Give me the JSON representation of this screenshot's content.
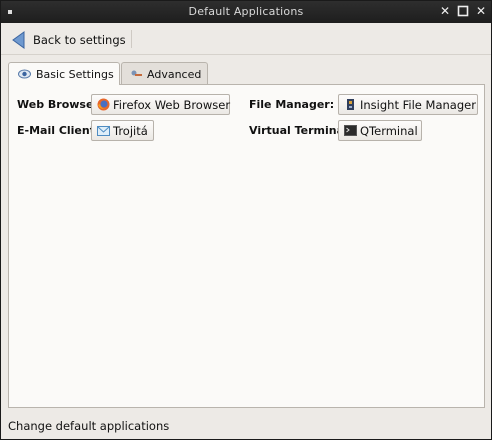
{
  "window": {
    "title": "Default Applications"
  },
  "toolbar": {
    "back_label": "Back to settings"
  },
  "tabs": [
    {
      "label": "Basic Settings",
      "icon": "eye-icon",
      "active": true
    },
    {
      "label": "Advanced",
      "icon": "settings-icon",
      "active": false
    }
  ],
  "fields": {
    "web_browser": {
      "label": "Web Browser:",
      "value": "Firefox Web Browser",
      "icon": "firefox-icon"
    },
    "file_manager": {
      "label": "File Manager:",
      "value": "Insight File Manager",
      "icon": "file-manager-icon"
    },
    "email_client": {
      "label": "E-Mail Client:",
      "value": "Trojitá",
      "icon": "email-icon"
    },
    "virtual_terminal": {
      "label": "Virtual Terminal:",
      "value": "QTerminal",
      "icon": "terminal-icon"
    }
  },
  "status": {
    "text": "Change default applications"
  }
}
